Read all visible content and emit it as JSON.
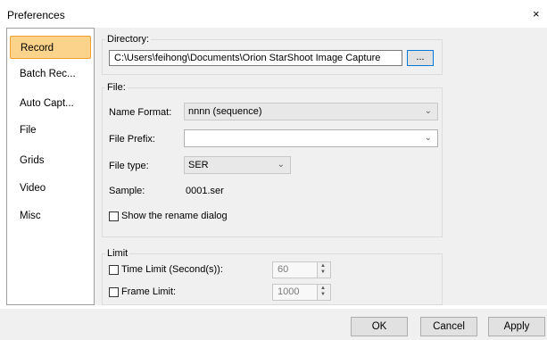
{
  "window": {
    "title": "Preferences",
    "close_glyph": "×"
  },
  "sidebar": {
    "items": [
      {
        "label": "Record"
      },
      {
        "label": "Batch Rec..."
      },
      {
        "label": "Auto Capt..."
      },
      {
        "label": "File"
      },
      {
        "label": "Grids"
      },
      {
        "label": "Video"
      },
      {
        "label": "Misc"
      }
    ]
  },
  "directory": {
    "label": "Directory:",
    "path": "C:\\Users\\feihong\\Documents\\Orion StarShoot Image Capture",
    "browse_label": "..."
  },
  "file": {
    "group_label": "File:",
    "name_format_label": "Name Format:",
    "name_format_value": "nnnn (sequence)",
    "prefix_label": "File Prefix:",
    "prefix_value": "",
    "type_label": "File type:",
    "type_value": "SER",
    "sample_label": "Sample:",
    "sample_value": "0001.ser",
    "rename_label": "Show the rename dialog"
  },
  "limit": {
    "group_label": "Limit",
    "time_label": "Time Limit (Second(s)):",
    "time_value": "60",
    "frame_label": "Frame Limit:",
    "frame_value": "1000"
  },
  "buttons": {
    "ok": "OK",
    "cancel": "Cancel",
    "apply": "Apply"
  },
  "icons": {
    "chevron": "chevron-down-icon",
    "spin_up": "▲",
    "spin_down": "▼"
  }
}
